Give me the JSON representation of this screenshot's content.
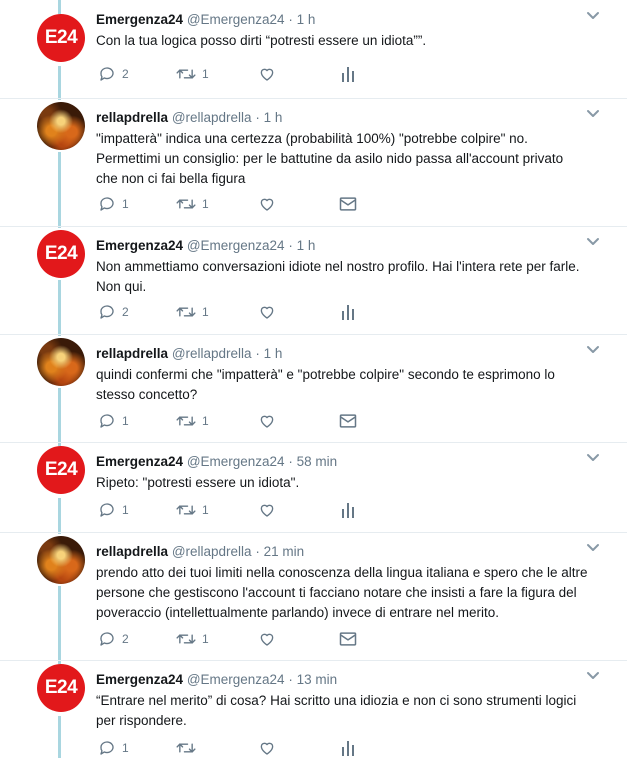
{
  "tweets": [
    {
      "name": "Emergenza24",
      "handle": "@Emergenza24",
      "sep": "·",
      "time": "1 h",
      "avatar": "e24-logo",
      "avatar_text": "E24",
      "lines": [
        "Con la tua logica posso dirti “potresti essere un idiota””."
      ],
      "reply_count": "2",
      "retweet_count": "1",
      "like_count": "",
      "extra": "analytics-icon"
    },
    {
      "name": "rellapdrella",
      "handle": "@rellapdrella",
      "sep": "·",
      "time": "1 h",
      "avatar": "fire-photo",
      "lines": [
        "\"impatterà\" indica una certezza (probabilità 100%) \"potrebbe colpire\" no.",
        "Permettimi un consiglio: per le battutine da asilo nido passa all'account privato",
        "che non ci fai bella figura"
      ],
      "reply_count": "1",
      "retweet_count": "1",
      "like_count": "",
      "extra": "message-icon"
    },
    {
      "name": "Emergenza24",
      "handle": "@Emergenza24",
      "sep": "·",
      "time": "1 h",
      "avatar": "e24-logo",
      "avatar_text": "E24",
      "lines": [
        "Non ammettiamo conversazioni idiote nel nostro profilo. Hai l'intera rete per farle.",
        "Non qui."
      ],
      "reply_count": "2",
      "retweet_count": "1",
      "like_count": "",
      "extra": "analytics-icon"
    },
    {
      "name": "rellapdrella",
      "handle": "@rellapdrella",
      "sep": "·",
      "time": "1 h",
      "avatar": "fire-photo",
      "lines": [
        "quindi confermi che \"impatterà\" e \"potrebbe colpire\" secondo te esprimono lo",
        "stesso concetto?"
      ],
      "reply_count": "1",
      "retweet_count": "1",
      "like_count": "",
      "extra": "message-icon"
    },
    {
      "name": "Emergenza24",
      "handle": "@Emergenza24",
      "sep": "·",
      "time": "58 min",
      "avatar": "e24-logo",
      "avatar_text": "E24",
      "lines": [
        "Ripeto: \"potresti essere un idiota\"."
      ],
      "reply_count": "1",
      "retweet_count": "1",
      "like_count": "",
      "extra": "analytics-icon"
    },
    {
      "name": "rellapdrella",
      "handle": "@rellapdrella",
      "sep": "·",
      "time": "21 min",
      "avatar": "fire-photo",
      "lines": [
        "prendo atto dei tuoi limiti nella conoscenza della lingua italiana e spero che le altre",
        "persone che gestiscono l'account ti facciano notare che insisti a fare la figura del",
        "poveraccio (intellettualmente parlando) invece di entrare nel merito."
      ],
      "reply_count": "2",
      "retweet_count": "1",
      "like_count": "",
      "extra": "message-icon"
    },
    {
      "name": "Emergenza24",
      "handle": "@Emergenza24",
      "sep": "·",
      "time": "13 min",
      "avatar": "e24-logo",
      "avatar_text": "E24",
      "lines": [
        "“Entrare nel merito” di cosa? Hai scritto una idiozia e non ci sono strumenti logici",
        "per rispondere."
      ],
      "reply_count": "1",
      "retweet_count": "",
      "like_count": "",
      "extra": "analytics-icon"
    }
  ],
  "colors": {
    "icon": "#657786",
    "thread_line": "#a9d6e0",
    "divider": "#e6ecf0",
    "e24_red": "#e2181b"
  }
}
